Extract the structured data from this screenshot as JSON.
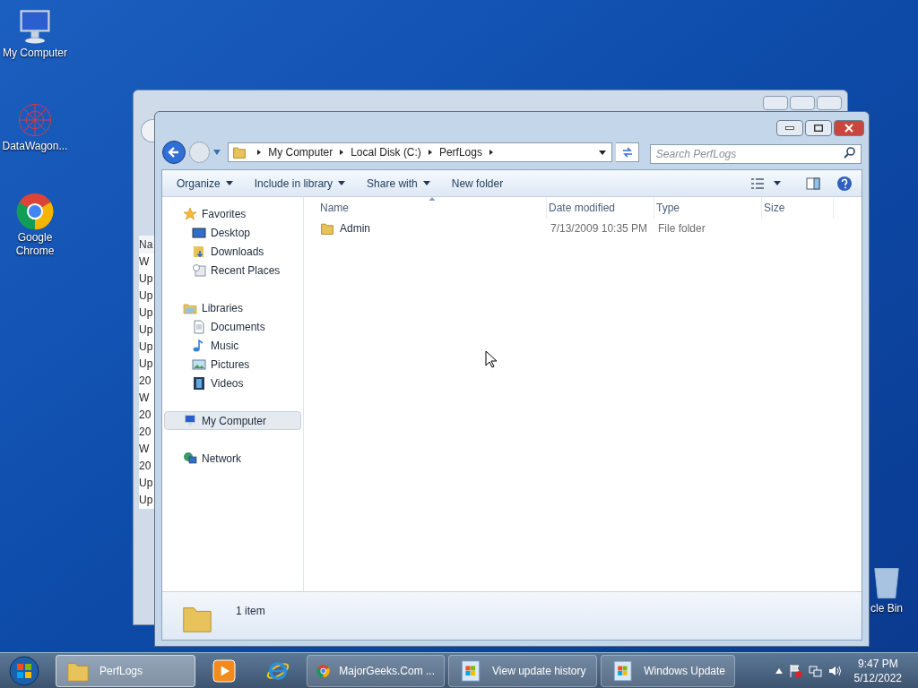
{
  "desktop_icons": [
    {
      "label": "My Computer",
      "kind": "computer"
    },
    {
      "label": "DataWagon...",
      "kind": "wagon"
    },
    {
      "label": "Google Chrome",
      "kind": "chrome"
    },
    {
      "label": "cle Bin",
      "kind": "bin"
    }
  ],
  "background_window": {
    "column_header": "Na",
    "cells": [
      "W",
      "Up",
      "Up",
      "Up",
      "Up",
      "Up",
      "Up",
      "20",
      "W",
      "20",
      "20",
      "W",
      "20",
      "Up",
      "Up"
    ]
  },
  "explorer": {
    "breadcrumb": [
      "My Computer",
      "Local Disk (C:)",
      "PerfLogs"
    ],
    "search": {
      "placeholder": "Search PerfLogs"
    },
    "toolbar": [
      {
        "label": "Organize",
        "dropdown": true
      },
      {
        "label": "Include in library",
        "dropdown": true
      },
      {
        "label": "Share with",
        "dropdown": true
      },
      {
        "label": "New folder",
        "dropdown": false
      }
    ],
    "nav": [
      {
        "label": "Favorites",
        "kind": "star",
        "selected": false,
        "children": [
          {
            "label": "Desktop",
            "kind": "desktop",
            "selected": false
          },
          {
            "label": "Downloads",
            "kind": "downloads",
            "selected": false
          },
          {
            "label": "Recent Places",
            "kind": "recent",
            "selected": false
          }
        ]
      },
      {
        "label": "Libraries",
        "kind": "libraries",
        "selected": false,
        "children": [
          {
            "label": "Documents",
            "kind": "documents",
            "selected": false
          },
          {
            "label": "Music",
            "kind": "music",
            "selected": false
          },
          {
            "label": "Pictures",
            "kind": "pictures",
            "selected": false
          },
          {
            "label": "Videos",
            "kind": "videos",
            "selected": false
          }
        ]
      },
      {
        "label": "My Computer",
        "kind": "computer",
        "selected": true
      },
      {
        "label": "Network",
        "kind": "network",
        "selected": false
      }
    ],
    "columns": [
      {
        "label": "Name",
        "sorted": true
      },
      {
        "label": "Date modified",
        "sorted": false
      },
      {
        "label": "Type",
        "sorted": false
      },
      {
        "label": "Size",
        "sorted": false
      }
    ],
    "rows": [
      {
        "name": "Admin",
        "date_modified": "7/13/2009 10:35 PM",
        "type": "File folder"
      }
    ],
    "details": {
      "count": "1 item"
    }
  },
  "taskbar": {
    "items": [
      {
        "kind": "folder",
        "label": "PerfLogs",
        "selected": true
      },
      {
        "kind": "media",
        "selected": false
      },
      {
        "kind": "ie",
        "selected": false
      },
      {
        "kind": "chrome",
        "label": "MajorGeeks.Com ...",
        "selected": false
      },
      {
        "kind": "update",
        "label": "View update history",
        "selected": false
      },
      {
        "kind": "update",
        "label": "Windows Update",
        "selected": false
      }
    ],
    "clock": {
      "time": "9:47 PM",
      "date": "5/12/2022"
    }
  }
}
